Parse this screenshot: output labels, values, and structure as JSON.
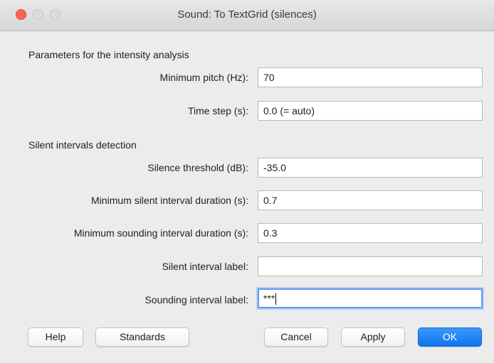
{
  "window": {
    "title": "Sound: To TextGrid (silences)"
  },
  "sections": {
    "intensity": "Parameters for the intensity analysis",
    "silence": "Silent intervals detection"
  },
  "fields": [
    {
      "label": "Minimum pitch (Hz):",
      "value": "70"
    },
    {
      "label": "Time step (s):",
      "value": "0.0 (= auto)"
    },
    {
      "label": "Silence threshold (dB):",
      "value": "-35.0"
    },
    {
      "label": "Minimum silent interval duration (s):",
      "value": "0.7"
    },
    {
      "label": "Minimum sounding interval duration (s):",
      "value": "0.3"
    },
    {
      "label": "Silent interval label:",
      "value": ""
    },
    {
      "label": "Sounding interval label:",
      "value": "***"
    }
  ],
  "buttons": {
    "help": "Help",
    "standards": "Standards",
    "cancel": "Cancel",
    "apply": "Apply",
    "ok": "OK"
  },
  "colors": {
    "close_button": "#fe5f57",
    "accent": "#1174f0",
    "focus_ring": "#5b9af2"
  }
}
